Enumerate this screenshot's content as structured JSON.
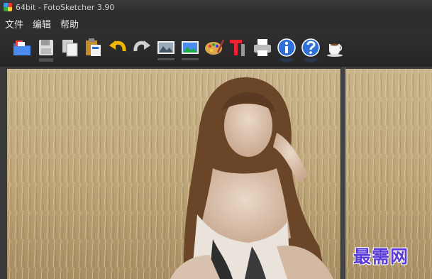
{
  "window": {
    "title": "64bit - FotoSketcher 3.90"
  },
  "menu": [
    {
      "label": "文件"
    },
    {
      "label": "编辑"
    },
    {
      "label": "帮助"
    }
  ],
  "toolbar": [
    {
      "icon": "open-folder-icon"
    },
    {
      "icon": "save-icon"
    },
    {
      "icon": "copy-icon"
    },
    {
      "icon": "paste-icon"
    },
    {
      "icon": "undo-icon"
    },
    {
      "icon": "redo-icon"
    },
    {
      "icon": "original-image-icon"
    },
    {
      "icon": "result-image-icon"
    },
    {
      "icon": "palette-icon"
    },
    {
      "icon": "text-icon"
    },
    {
      "icon": "print-icon"
    },
    {
      "icon": "info-icon"
    },
    {
      "icon": "help-icon"
    },
    {
      "icon": "coffee-icon"
    }
  ],
  "watermark": "最需网",
  "colors": {
    "window_bg": "#2b2b2b",
    "toolbar_bg": "#2a2a2a",
    "accent_blue": "#2f6fd6"
  }
}
